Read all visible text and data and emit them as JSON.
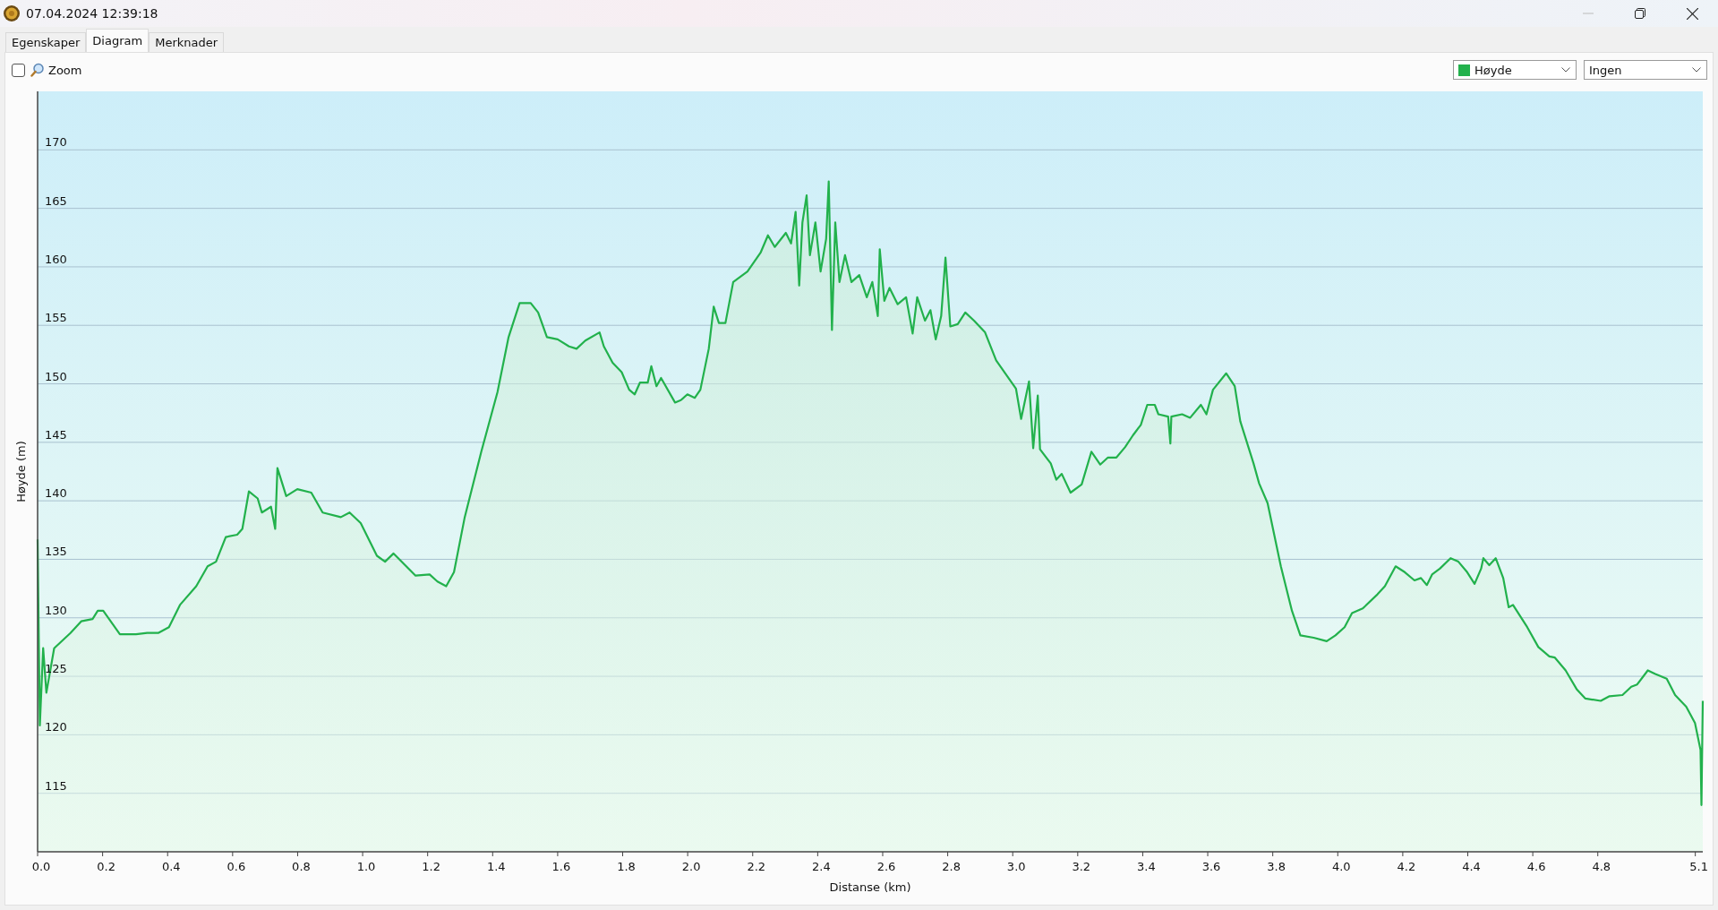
{
  "window": {
    "title": "07.04.2024 12:39:18"
  },
  "tabs": [
    {
      "label": "Egenskaper",
      "selected": false
    },
    {
      "label": "Diagram",
      "selected": true
    },
    {
      "label": "Merknader",
      "selected": false
    }
  ],
  "toolbar": {
    "zoom": {
      "label": "Zoom",
      "checked": false
    },
    "second_select": {
      "value": "Ingen"
    }
  },
  "chart": {
    "chart_data": {
      "type": "area",
      "grid": true,
      "xlabel": "Distanse (km)",
      "ylabel": "Høyde (m)",
      "xlim": [
        0,
        5.123
      ],
      "ylim": [
        110,
        175
      ],
      "xticks": [
        {
          "value": 0,
          "label": "0.0"
        },
        {
          "value": 0.2,
          "label": "0.2"
        },
        {
          "value": 0.4,
          "label": "0.4"
        },
        {
          "value": 0.6,
          "label": "0.6"
        },
        {
          "value": 0.8,
          "label": "0.8"
        },
        {
          "value": 1,
          "label": "1.0"
        },
        {
          "value": 1.2,
          "label": "1.2"
        },
        {
          "value": 1.4,
          "label": "1.4"
        },
        {
          "value": 1.6,
          "label": "1.6"
        },
        {
          "value": 1.8,
          "label": "1.8"
        },
        {
          "value": 2,
          "label": "2.0"
        },
        {
          "value": 2.2,
          "label": "2.2"
        },
        {
          "value": 2.4,
          "label": "2.4"
        },
        {
          "value": 2.6,
          "label": "2.6"
        },
        {
          "value": 2.8,
          "label": "2.8"
        },
        {
          "value": 3,
          "label": "3.0"
        },
        {
          "value": 3.2,
          "label": "3.2"
        },
        {
          "value": 3.4,
          "label": "3.4"
        },
        {
          "value": 3.6,
          "label": "3.6"
        },
        {
          "value": 3.8,
          "label": "3.8"
        },
        {
          "value": 4,
          "label": "4.0"
        },
        {
          "value": 4.2,
          "label": "4.2"
        },
        {
          "value": 4.4,
          "label": "4.4"
        },
        {
          "value": 4.6,
          "label": "4.6"
        },
        {
          "value": 4.8,
          "label": "4.8"
        },
        {
          "value": 5.1,
          "label": "5.1"
        }
      ],
      "yticks": [
        115,
        120,
        125,
        130,
        135,
        140,
        145,
        150,
        155,
        160,
        165,
        170
      ],
      "x": [
        0,
        0.007,
        0.017,
        0.027,
        0.051,
        0.101,
        0.134,
        0.169,
        0.185,
        0.202,
        0.253,
        0.303,
        0.337,
        0.371,
        0.404,
        0.438,
        0.488,
        0.523,
        0.549,
        0.579,
        0.614,
        0.63,
        0.65,
        0.677,
        0.69,
        0.718,
        0.731,
        0.738,
        0.765,
        0.799,
        0.842,
        0.877,
        0.933,
        0.96,
        0.994,
        1.044,
        1.069,
        1.095,
        1.163,
        1.206,
        1.23,
        1.257,
        1.281,
        1.314,
        1.365,
        1.415,
        1.449,
        1.483,
        1.517,
        1.54,
        1.567,
        1.6,
        1.635,
        1.658,
        1.685,
        1.729,
        1.742,
        1.769,
        1.797,
        1.82,
        1.837,
        1.853,
        1.877,
        1.888,
        1.904,
        1.918,
        1.961,
        1.979,
        1.999,
        2.022,
        2.039,
        2.065,
        2.08,
        2.096,
        2.116,
        2.14,
        2.184,
        2.224,
        2.247,
        2.268,
        2.302,
        2.318,
        2.332,
        2.343,
        2.353,
        2.366,
        2.376,
        2.393,
        2.409,
        2.426,
        2.434,
        2.444,
        2.454,
        2.467,
        2.484,
        2.504,
        2.528,
        2.551,
        2.568,
        2.585,
        2.591,
        2.605,
        2.621,
        2.646,
        2.672,
        2.692,
        2.706,
        2.73,
        2.747,
        2.763,
        2.78,
        2.793,
        2.808,
        2.831,
        2.854,
        2.881,
        2.915,
        2.949,
        3.01,
        3.026,
        3.05,
        3.063,
        3.077,
        3.084,
        3.117,
        3.134,
        3.151,
        3.178,
        3.212,
        3.242,
        3.269,
        3.293,
        3.319,
        3.346,
        3.37,
        3.394,
        3.414,
        3.437,
        3.448,
        3.478,
        3.485,
        3.488,
        3.521,
        3.546,
        3.579,
        3.596,
        3.616,
        3.657,
        3.683,
        3.7,
        3.741,
        3.758,
        3.784,
        3.825,
        3.859,
        3.885,
        3.926,
        3.966,
        3.993,
        4.021,
        4.044,
        4.077,
        4.122,
        4.145,
        4.178,
        4.206,
        4.236,
        4.256,
        4.274,
        4.29,
        4.314,
        4.347,
        4.371,
        4.398,
        4.421,
        4.441,
        4.448,
        4.466,
        4.486,
        4.509,
        4.526,
        4.539,
        4.583,
        4.617,
        4.651,
        4.668,
        4.701,
        4.735,
        4.762,
        4.809,
        4.836,
        4.876,
        4.903,
        4.921,
        4.954,
        4.977,
        5.012,
        5.038,
        5.072,
        5.099,
        5.116,
        5.119,
        5.123
      ],
      "series": [
        {
          "name": "Høyde",
          "color": "#22b14c",
          "values": [
            136.7,
            120.8,
            127.4,
            123.6,
            127.4,
            128.7,
            129.7,
            129.9,
            130.6,
            130.6,
            128.6,
            128.6,
            128.7,
            128.7,
            129.2,
            131.1,
            132.7,
            134.4,
            134.8,
            136.9,
            137.1,
            137.6,
            140.8,
            140.2,
            139,
            139.5,
            137.6,
            142.8,
            140.4,
            141,
            140.7,
            139,
            138.6,
            139,
            138.1,
            135.3,
            134.8,
            135.5,
            133.6,
            133.7,
            133.1,
            132.7,
            133.9,
            138.6,
            144.2,
            149.3,
            154,
            156.9,
            156.9,
            156.1,
            154,
            153.8,
            153.2,
            153,
            153.7,
            154.4,
            153.2,
            151.8,
            151,
            149.5,
            149.1,
            150.1,
            150.1,
            151.5,
            149.8,
            150.5,
            148.4,
            148.6,
            149.1,
            148.8,
            149.5,
            153,
            156.6,
            155.2,
            155.2,
            158.7,
            159.6,
            161.2,
            162.7,
            161.7,
            162.9,
            162,
            164.7,
            158.4,
            163.8,
            166.1,
            161,
            163.8,
            159.6,
            162.4,
            167.3,
            154.6,
            163.8,
            158.7,
            161,
            158.7,
            159.3,
            157.4,
            158.7,
            155.8,
            161.5,
            157.1,
            158.2,
            156.8,
            157.4,
            154.3,
            157.4,
            155.4,
            156.3,
            153.8,
            155.8,
            160.8,
            154.9,
            155.1,
            156.1,
            155.4,
            154.4,
            152,
            149.6,
            147,
            150.2,
            144.5,
            149,
            144.4,
            143.2,
            141.8,
            142.3,
            140.7,
            141.4,
            144.2,
            143.1,
            143.7,
            143.7,
            144.6,
            145.6,
            146.5,
            148.2,
            148.2,
            147.4,
            147.2,
            144.9,
            147.2,
            147.4,
            147.1,
            148.2,
            147.4,
            149.5,
            150.9,
            149.8,
            146.8,
            143.2,
            141.5,
            139.8,
            134.4,
            130.6,
            128.5,
            128.3,
            128,
            128.5,
            129.2,
            130.4,
            130.8,
            132,
            132.7,
            134.4,
            133.9,
            133.2,
            133.4,
            132.8,
            133.7,
            134.2,
            135.1,
            134.8,
            133.9,
            132.9,
            134.2,
            135.1,
            134.5,
            135.1,
            133.4,
            130.9,
            131.1,
            129.2,
            127.5,
            126.7,
            126.6,
            125.5,
            123.9,
            123.1,
            122.9,
            123.3,
            123.4,
            124.1,
            124.3,
            125.5,
            125.2,
            124.8,
            123.4,
            122.4,
            121,
            118.7,
            114,
            122.9
          ]
        }
      ]
    }
  }
}
